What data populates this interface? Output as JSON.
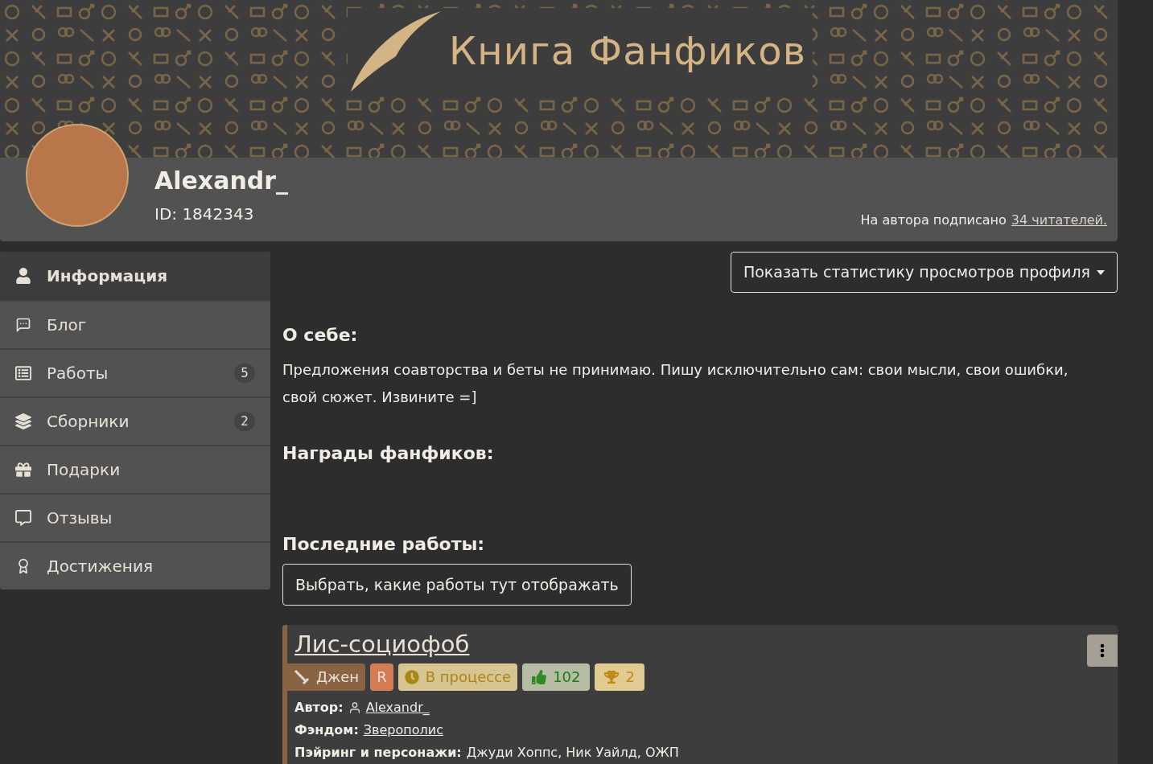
{
  "site": {
    "logo_text": "Книга Фанфиков"
  },
  "profile": {
    "username": "Alexandr_",
    "id_text": "ID: 1842343",
    "subscribers_prefix": "На автора подписано",
    "subscribers_link": "34 читателей."
  },
  "sidebar": {
    "items": [
      {
        "label": "Информация",
        "selected": true
      },
      {
        "label": "Блог",
        "selected": false
      },
      {
        "label": "Работы",
        "selected": false,
        "count": "5"
      },
      {
        "label": "Сборники",
        "selected": false,
        "count": "2"
      },
      {
        "label": "Подарки",
        "selected": false
      },
      {
        "label": "Отзывы",
        "selected": false
      },
      {
        "label": "Достижения",
        "selected": false
      }
    ]
  },
  "stats_button": "Показать статистику просмотров профиля",
  "about": {
    "heading": "О себе:",
    "text": "Предложения соавторства и беты не принимаю. Пишу исключительно сам: свои мысли, свои ошибки, свой сюжет. Извините =]"
  },
  "awards": {
    "heading": "Награды фанфиков:"
  },
  "recent_works": {
    "heading": "Последние работы:",
    "choose_button": "Выбрать, какие работы тут отображать",
    "works": [
      {
        "title": "Лис-социофоб",
        "tags": [
          {
            "kind": "direction",
            "text": "Джен"
          },
          {
            "kind": "rating",
            "text": "R"
          },
          {
            "kind": "status",
            "text": "В процессе"
          },
          {
            "kind": "likes",
            "text": "102"
          },
          {
            "kind": "rewards",
            "text": "2"
          }
        ],
        "fields": [
          {
            "kind": "author",
            "label": "Автор:",
            "value": "Alexandr_"
          },
          {
            "kind": "link",
            "label": "Фэндом:",
            "value": "Зверополис"
          },
          {
            "kind": "text",
            "label": "Пэйринг и персонажи:",
            "value": "Джуди Хоппс, Ник Уайлд, ОЖП"
          }
        ]
      }
    ]
  }
}
